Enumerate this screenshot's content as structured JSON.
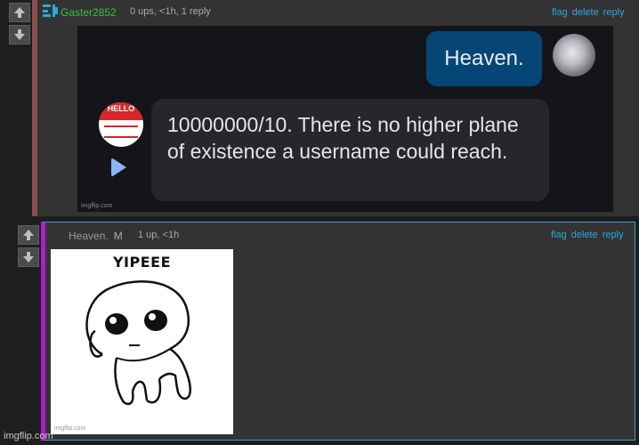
{
  "comment1": {
    "username": "Gaster2852",
    "meta": "0 ups, <1h, 1 reply",
    "actions": [
      "flag",
      "delete",
      "reply"
    ],
    "image": {
      "right_bubble_text": "Heaven.",
      "hello_tag": "HELLO",
      "left_bubble_text": "10000000/10. There is no higher plane of existence a username could reach.",
      "watermark": "imgflip.com"
    }
  },
  "comment2": {
    "username": "Heaven.",
    "mod_badge": "M",
    "meta": "1 up, <1h",
    "actions": [
      "flag",
      "delete",
      "reply"
    ],
    "image": {
      "caption": "YIPEEE",
      "watermark": "imgflip.com"
    }
  },
  "footer_watermark": "imgflip.com",
  "colors": {
    "username_green": "#3fbf3f",
    "link_blue": "#2aa7d9",
    "bubble_blue": "#064676",
    "mod_bar": "#b01bd6"
  }
}
